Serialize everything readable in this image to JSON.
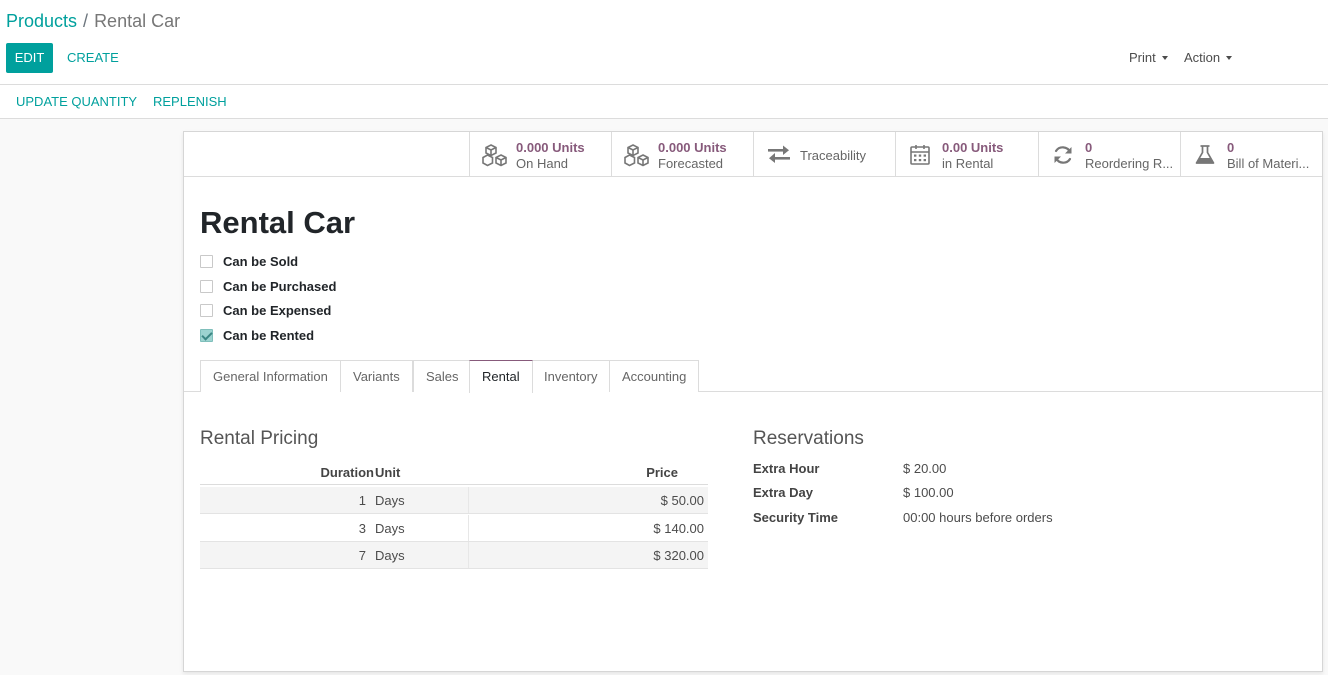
{
  "breadcrumb": {
    "parent": "Products",
    "separator": "/",
    "current": "Rental Car"
  },
  "toolbar": {
    "edit_label": "EDIT",
    "create_label": "CREATE",
    "print_label": "Print",
    "action_label": "Action"
  },
  "statusbar": {
    "update_quantity_label": "UPDATE QUANTITY",
    "replenish_label": "REPLENISH"
  },
  "smart_buttons": [
    {
      "icon": "cubes-icon",
      "value": "0.000 Units",
      "label": "On Hand"
    },
    {
      "icon": "cubes-icon",
      "value": "0.000 Units",
      "label": "Forecasted"
    },
    {
      "icon": "exchange-arrows-icon",
      "label": "Traceability"
    },
    {
      "icon": "calendar-icon",
      "value": "0.00 Units",
      "label": "in Rental"
    },
    {
      "icon": "refresh-icon",
      "value": "0",
      "label": "Reordering R..."
    },
    {
      "icon": "flask-icon",
      "value": "0",
      "label": "Bill of Materi..."
    }
  ],
  "product": {
    "name": "Rental Car",
    "flags": [
      {
        "label": "Can be Sold",
        "checked": false
      },
      {
        "label": "Can be Purchased",
        "checked": false
      },
      {
        "label": "Can be Expensed",
        "checked": false
      },
      {
        "label": "Can be Rented",
        "checked": true
      }
    ]
  },
  "tabs": [
    {
      "label": "General Information",
      "active": false
    },
    {
      "label": "Variants",
      "active": false
    },
    {
      "label": "Sales",
      "active": false
    },
    {
      "label": "Rental",
      "active": true
    },
    {
      "label": "Inventory",
      "active": false
    },
    {
      "label": "Accounting",
      "active": false
    }
  ],
  "rental_pricing": {
    "title": "Rental Pricing",
    "columns": {
      "duration": "Duration",
      "unit": "Unit",
      "price": "Price"
    },
    "rows": [
      {
        "duration": "1",
        "unit": "Days",
        "price": "$ 50.00"
      },
      {
        "duration": "3",
        "unit": "Days",
        "price": "$ 140.00"
      },
      {
        "duration": "7",
        "unit": "Days",
        "price": "$ 320.00"
      }
    ]
  },
  "reservations": {
    "title": "Reservations",
    "fields": [
      {
        "label": "Extra Hour",
        "value": "$ 20.00"
      },
      {
        "label": "Extra Day",
        "value": "$ 100.00"
      },
      {
        "label": "Security Time",
        "value": "00:00 hours before orders"
      }
    ]
  },
  "colors": {
    "brand_teal": "#00a09d",
    "accent_purple": "#875a7b",
    "check_fill": "#9cd3d0"
  }
}
